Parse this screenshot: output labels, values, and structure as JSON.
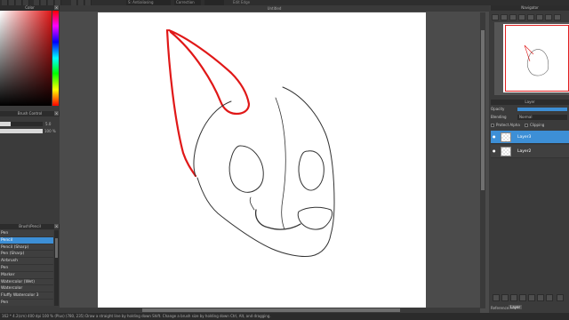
{
  "toolbar": {
    "stabilizer_value": "S: Antialiasing",
    "mode_value": "Correction",
    "edge_value": "",
    "edge_label": "Edit Edge"
  },
  "canvas": {
    "tab_title": "Untitled"
  },
  "color_panel": {
    "title": "Color",
    "primary_color": "#e01818"
  },
  "brush_control": {
    "title": "Brush Control",
    "size_value": "5.0",
    "opacity_value": "100 %",
    "size_fraction": 0.25,
    "opacity_fraction": 1.0
  },
  "brush_panel": {
    "title": "Brush\\Pencil",
    "items": [
      "Pen",
      "Pencil",
      "Pencil (Sharp)",
      "Pen (Sharp)",
      "Airbrush",
      "Pen",
      "Marker",
      "Watercolor (Wet)",
      "Watercolor",
      "Fluffy Watercolor 3",
      "Pen"
    ],
    "selected_index": 1
  },
  "navigator": {
    "title": "Navigator"
  },
  "layer_panel": {
    "title": "Layer",
    "opacity_label": "Opacity",
    "blending_label": "Blending",
    "blending_value": "Normal",
    "protect_alpha_label": "Protect Alpha",
    "clipping_label": "Clipping",
    "layers": [
      {
        "name": "Layer3",
        "selected": true
      },
      {
        "name": "Layer2",
        "selected": false
      }
    ]
  },
  "bottom": {
    "reference_label": "Reference",
    "layer_tab_label": "Layer"
  },
  "status": {
    "text": "162 * 4.2(cm)   400 dpi   100 % (Plus)   (780, 235)   Draw a straight line by holding down Shift. Change a brush size by holding down Ctrl, Alt, and dragging."
  },
  "colors": {
    "accent": "#3d8fd6",
    "stroke_red": "#e01818",
    "stroke_black": "#333333"
  }
}
